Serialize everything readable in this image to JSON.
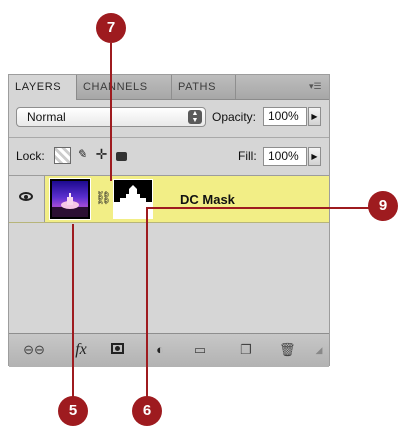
{
  "panel": {
    "tabs": [
      {
        "label": "LAYERS"
      },
      {
        "label": "CHANNELS"
      },
      {
        "label": "PATHS"
      }
    ],
    "menu_icon": "panel-menu-icon",
    "blend_mode": "Normal",
    "opacity_label": "Opacity:",
    "opacity_value": "100%",
    "lock_label": "Lock:",
    "fill_label": "Fill:",
    "fill_value": "100%",
    "layer": {
      "name": "DC Mask"
    }
  },
  "callouts": {
    "c7": "7",
    "c9": "9",
    "c5": "5",
    "c6": "6"
  },
  "colors": {
    "callout": "#9e1b1f",
    "layer_selected": "#f2ee86"
  }
}
